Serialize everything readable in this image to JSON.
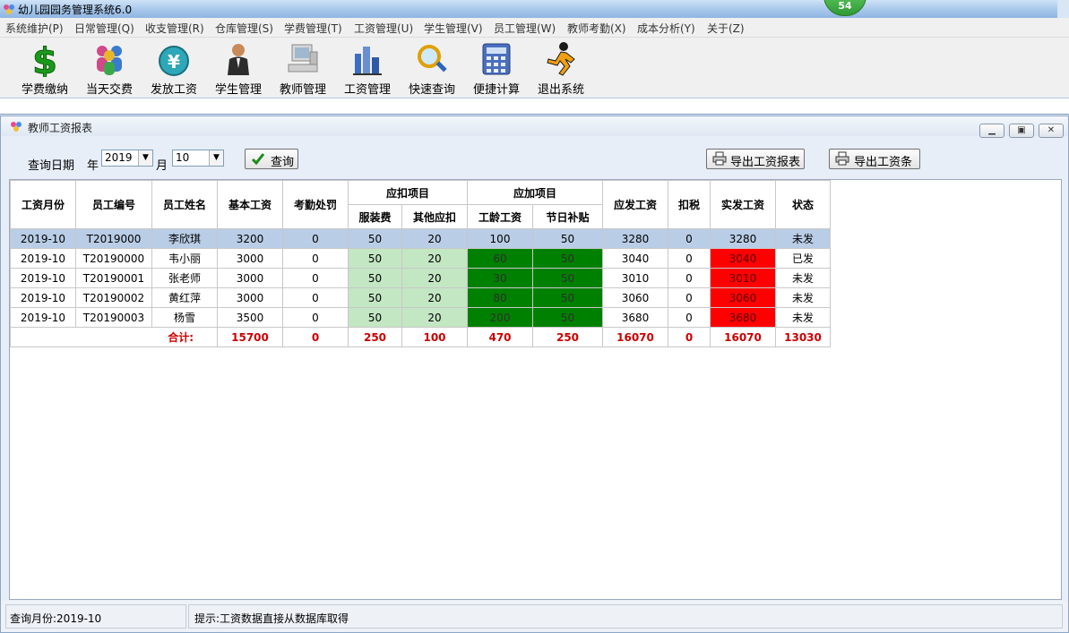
{
  "window": {
    "title": "幼儿园园务管理系统6.0",
    "badge": "54"
  },
  "menu": [
    "系统维护(P)",
    "日常管理(Q)",
    "收支管理(R)",
    "仓库管理(S)",
    "学费管理(T)",
    "工资管理(U)",
    "学生管理(V)",
    "员工管理(W)",
    "教师考勤(X)",
    "成本分析(Y)",
    "关于(Z)"
  ],
  "toolbar": {
    "items": [
      {
        "label": "学费缴纳",
        "icon": "dollar-icon"
      },
      {
        "label": "当天交费",
        "icon": "people-icon"
      },
      {
        "label": "发放工资",
        "icon": "yen-coin-icon"
      },
      {
        "label": "学生管理",
        "icon": "person-icon"
      },
      {
        "label": "教师管理",
        "icon": "computer-icon"
      },
      {
        "label": "工资管理",
        "icon": "buildings-icon"
      },
      {
        "label": "快速查询",
        "icon": "magnifier-icon"
      },
      {
        "label": "便捷计算",
        "icon": "calculator-icon"
      },
      {
        "label": "退出系统",
        "icon": "runner-icon"
      }
    ]
  },
  "report_window": {
    "title": "教师工资报表",
    "query": {
      "date_label": "查询日期",
      "year_label": "年",
      "year_value": "2019",
      "month_label": "月",
      "month_value": "10",
      "query_button": "查询",
      "export_report_button": "导出工资报表",
      "export_slip_button": "导出工资条"
    }
  },
  "table": {
    "headers": {
      "month": "工资月份",
      "emp_no": "员工编号",
      "name": "员工姓名",
      "base": "基本工资",
      "penalty": "考勤处罚",
      "deduct_group": "应扣项目",
      "clothing": "服装费",
      "other_deduct": "其他应扣",
      "add_group": "应加项目",
      "seniority": "工龄工资",
      "holiday": "节日补贴",
      "gross": "应发工资",
      "tax": "扣税",
      "net": "实发工资",
      "status": "状态"
    },
    "rows": [
      {
        "month": "2019-10",
        "emp_no": "T2019000",
        "name": "李欣琪",
        "base": "3200",
        "penalty": "0",
        "clothing": "50",
        "other_deduct": "20",
        "seniority": "100",
        "holiday": "50",
        "gross": "3280",
        "tax": "0",
        "net": "3280",
        "status": "未发"
      },
      {
        "month": "2019-10",
        "emp_no": "T20190000",
        "name": "韦小丽",
        "base": "3000",
        "penalty": "0",
        "clothing": "50",
        "other_deduct": "20",
        "seniority": "60",
        "holiday": "50",
        "gross": "3040",
        "tax": "0",
        "net": "3040",
        "status": "已发"
      },
      {
        "month": "2019-10",
        "emp_no": "T20190001",
        "name": "张老师",
        "base": "3000",
        "penalty": "0",
        "clothing": "50",
        "other_deduct": "20",
        "seniority": "30",
        "holiday": "50",
        "gross": "3010",
        "tax": "0",
        "net": "3010",
        "status": "未发"
      },
      {
        "month": "2019-10",
        "emp_no": "T20190002",
        "name": "黄红萍",
        "base": "3000",
        "penalty": "0",
        "clothing": "50",
        "other_deduct": "20",
        "seniority": "80",
        "holiday": "50",
        "gross": "3060",
        "tax": "0",
        "net": "3060",
        "status": "未发"
      },
      {
        "month": "2019-10",
        "emp_no": "T20190003",
        "name": "杨雪",
        "base": "3500",
        "penalty": "0",
        "clothing": "50",
        "other_deduct": "20",
        "seniority": "200",
        "holiday": "50",
        "gross": "3680",
        "tax": "0",
        "net": "3680",
        "status": "未发"
      }
    ],
    "totals": {
      "label": "合计:",
      "base": "15700",
      "penalty": "0",
      "clothing": "250",
      "other_deduct": "100",
      "seniority": "470",
      "holiday": "250",
      "gross": "16070",
      "tax": "0",
      "net": "16070",
      "status": "13030"
    }
  },
  "statusbar": {
    "month": "查询月份:2019-10",
    "hint": "提示:工资数据直接从数据库取得"
  }
}
